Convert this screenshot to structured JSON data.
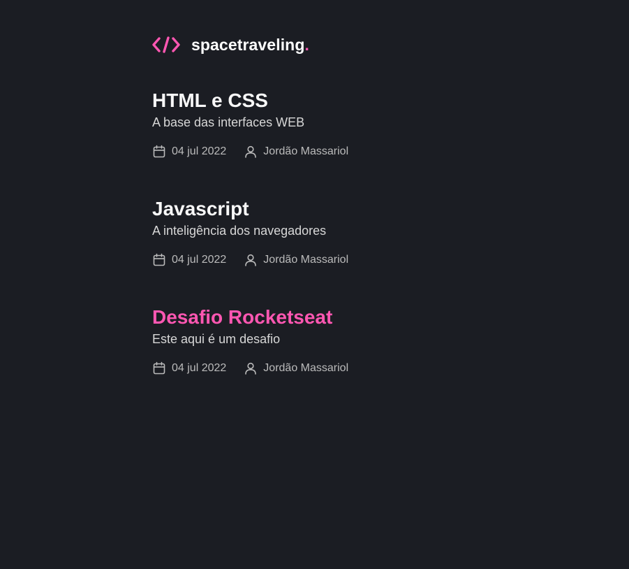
{
  "brand": {
    "name": "spacetraveling",
    "dot": ".",
    "accent_color": "#ff57b2",
    "icon": "code-brackets-icon"
  },
  "posts": [
    {
      "title": "HTML e CSS",
      "subtitle": "A base das interfaces WEB",
      "date": "04 jul 2022",
      "author": "Jordão Massariol",
      "highlighted": false
    },
    {
      "title": "Javascript",
      "subtitle": "A inteligência dos navegadores",
      "date": "04 jul 2022",
      "author": "Jordão Massariol",
      "highlighted": false
    },
    {
      "title": "Desafio Rocketseat",
      "subtitle": "Este aqui é um desafio",
      "date": "04 jul 2022",
      "author": "Jordão Massariol",
      "highlighted": true
    }
  ],
  "icons": {
    "date": "calendar-icon",
    "author": "user-icon"
  },
  "colors": {
    "background": "#1b1d23",
    "title": "#f8f8f8",
    "subtitle": "#d7d7d7",
    "info": "#bbbbbb"
  }
}
